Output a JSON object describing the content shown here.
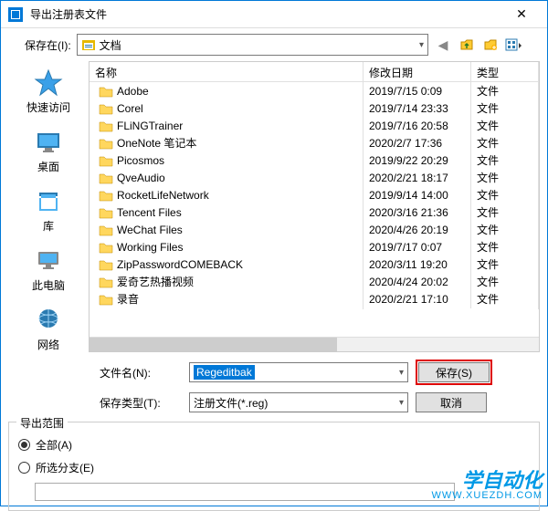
{
  "title": "导出注册表文件",
  "lookin": {
    "label": "保存在(I):",
    "value": "文档"
  },
  "columns": {
    "name": "名称",
    "date": "修改日期",
    "type": "类型"
  },
  "type_value": "文件",
  "rows": [
    {
      "name": "Adobe",
      "date": "2019/7/15 0:09"
    },
    {
      "name": "Corel",
      "date": "2019/7/14 23:33"
    },
    {
      "name": "FLiNGTrainer",
      "date": "2019/7/16 20:58"
    },
    {
      "name": "OneNote 笔记本",
      "date": "2020/2/7 17:36"
    },
    {
      "name": "Picosmos",
      "date": "2019/9/22 20:29"
    },
    {
      "name": "QveAudio",
      "date": "2020/2/21 18:17"
    },
    {
      "name": "RocketLifeNetwork",
      "date": "2019/9/14 14:00"
    },
    {
      "name": "Tencent Files",
      "date": "2020/3/16 21:36"
    },
    {
      "name": "WeChat Files",
      "date": "2020/4/26 20:19"
    },
    {
      "name": "Working Files",
      "date": "2019/7/17 0:07"
    },
    {
      "name": "ZipPasswordCOMEBACK",
      "date": "2020/3/11 19:20"
    },
    {
      "name": "爱奇艺热播视频",
      "date": "2020/4/24 20:02"
    },
    {
      "name": "录音",
      "date": "2020/2/21 17:10"
    }
  ],
  "places": {
    "quick": "快速访问",
    "desktop": "桌面",
    "libraries": "库",
    "pc": "此电脑",
    "network": "网络"
  },
  "filename": {
    "label": "文件名(N):",
    "value": "Regeditbak"
  },
  "filetype": {
    "label": "保存类型(T):",
    "value": "注册文件(*.reg)"
  },
  "buttons": {
    "save": "保存(S)",
    "cancel": "取消"
  },
  "export": {
    "title": "导出范围",
    "all": "全部(A)",
    "branch": "所选分支(E)"
  },
  "watermark": {
    "text": "学自动化",
    "url": "WWW.XUEZDH.COM"
  }
}
